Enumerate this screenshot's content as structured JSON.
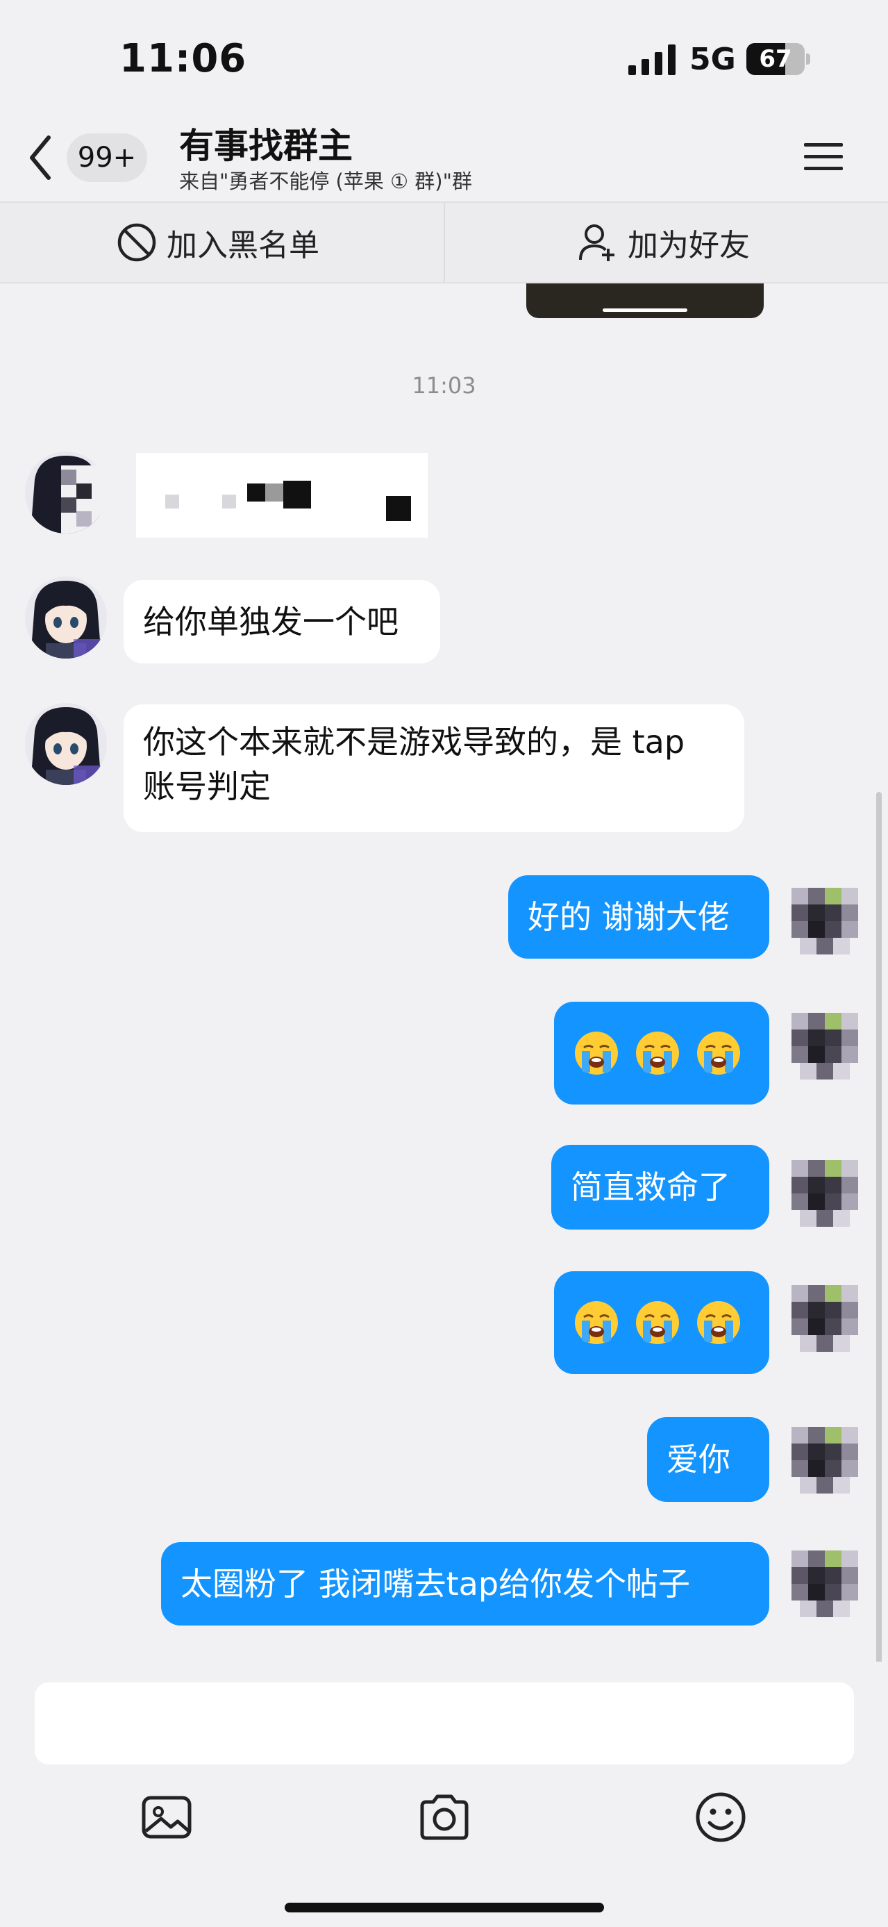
{
  "status_bar": {
    "time": "11:06",
    "network": "5G",
    "battery_level": "67",
    "battery_fraction": 0.67
  },
  "header": {
    "unread_count": "99+",
    "title": "有事找群主",
    "subtitle": "来自\"勇者不能停 (苹果 ① 群)\"群",
    "icons": {
      "back": "chevron-left-icon",
      "menu": "hamburger-menu-icon"
    }
  },
  "actions": {
    "blacklist_label": "加入黑名单",
    "add_friend_label": "加为好友",
    "icons": {
      "blacklist": "block-icon",
      "add_friend": "add-user-icon"
    }
  },
  "timestamp": "11:03",
  "messages": [
    {
      "direction": "in",
      "type": "redacted-image"
    },
    {
      "direction": "in",
      "type": "text",
      "text": "给你单独发一个吧"
    },
    {
      "direction": "in",
      "type": "text",
      "text": "你这个本来就不是游戏导致的，是 tap 账号判定"
    },
    {
      "direction": "out",
      "type": "text",
      "text": "好的 谢谢大佬"
    },
    {
      "direction": "out",
      "type": "emoji",
      "emoji": "loudly-crying-face",
      "count": 3
    },
    {
      "direction": "out",
      "type": "text",
      "text": "简直救命了"
    },
    {
      "direction": "out",
      "type": "emoji",
      "emoji": "loudly-crying-face",
      "count": 3
    },
    {
      "direction": "out",
      "type": "text",
      "text": "爱你"
    },
    {
      "direction": "out",
      "type": "text",
      "text": "太圈粉了 我闭嘴去tap给你发个帖子"
    }
  ],
  "composer": {
    "input_value": "",
    "icons": {
      "image": "image-icon",
      "camera": "camera-icon",
      "emoji": "smiley-icon"
    }
  },
  "colors": {
    "background": "#f1f1f3",
    "outgoing_bubble": "#1394ff",
    "incoming_bubble": "#ffffff"
  }
}
